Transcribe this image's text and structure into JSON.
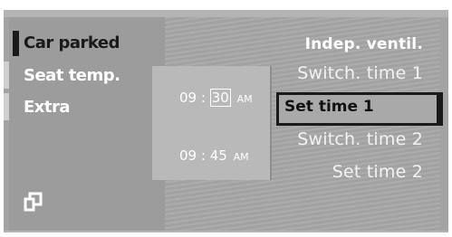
{
  "left_menu": {
    "items": [
      {
        "label": "Car parked",
        "selected": true
      },
      {
        "label": "Seat temp.",
        "selected": false
      },
      {
        "label": "Extra",
        "selected": false
      }
    ],
    "back_icon": "back-arrow-icon"
  },
  "times": {
    "time1": {
      "hour": "09",
      "minute": "30",
      "ampm": "AM"
    },
    "time2": {
      "hour": "09",
      "minute": "45",
      "ampm": "AM"
    }
  },
  "right_menu": {
    "title": "Indep. ventil.",
    "items": [
      {
        "label": "Switch. time 1"
      },
      {
        "label": "Set time 1",
        "selected": true
      },
      {
        "label": "Switch. time 2"
      },
      {
        "label": "Set time 2"
      }
    ]
  },
  "colors": {
    "background": "#a3a3a3",
    "text": "#ffffff",
    "selection": "#1a1a1a"
  }
}
